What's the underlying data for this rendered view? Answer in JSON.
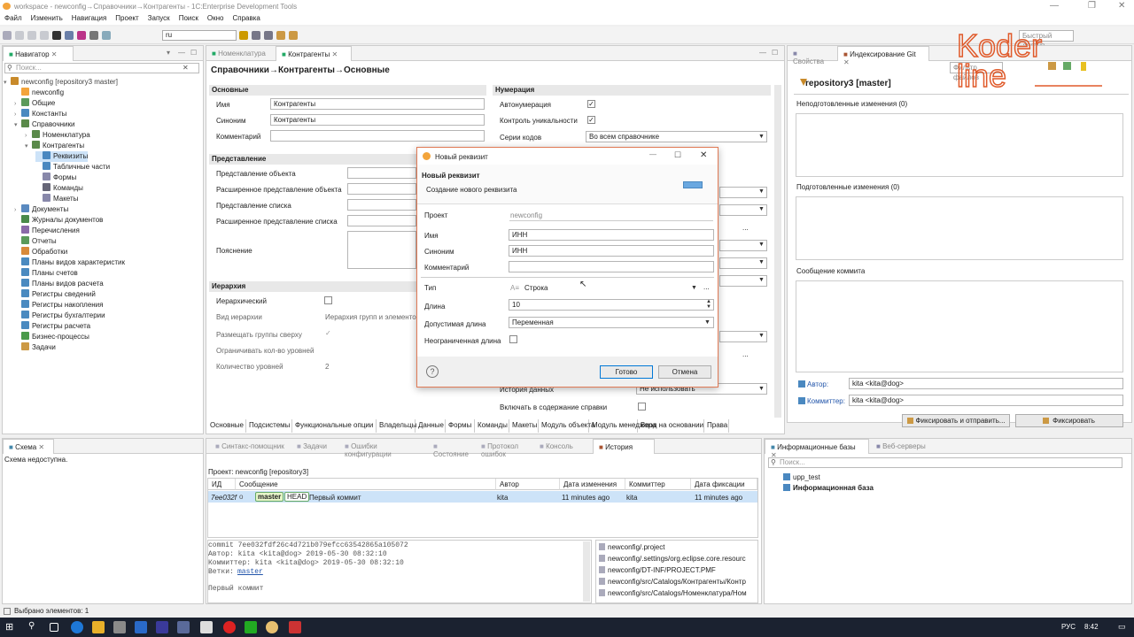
{
  "window": {
    "title": "workspace - newconfig→Справочники→Контрагенты - 1C:Enterprise Development Tools"
  },
  "menu": [
    "Файл",
    "Изменить",
    "Навигация",
    "Проект",
    "Запуск",
    "Поиск",
    "Окно",
    "Справка"
  ],
  "toolbar": {
    "lang_combo": "ru",
    "quick_access": "Быстрый доступ"
  },
  "navigator": {
    "tab": "Навигатор",
    "search_placeholder": "Поиск...",
    "items": [
      {
        "label": "newconfig [repository3 master]",
        "level": 0,
        "arrow": "▾"
      },
      {
        "label": "newconfig",
        "level": 1,
        "arrow": ""
      },
      {
        "label": "Общие",
        "level": 1,
        "arrow": "›"
      },
      {
        "label": "Константы",
        "level": 1,
        "arrow": "›"
      },
      {
        "label": "Справочники",
        "level": 1,
        "arrow": "▾"
      },
      {
        "label": "Номенклатура",
        "level": 2,
        "arrow": "›"
      },
      {
        "label": "Контрагенты",
        "level": 2,
        "arrow": "▾"
      },
      {
        "label": "Реквизиты",
        "level": 3,
        "arrow": ""
      },
      {
        "label": "Табличные части",
        "level": 3,
        "arrow": ""
      },
      {
        "label": "Формы",
        "level": 3,
        "arrow": ""
      },
      {
        "label": "Команды",
        "level": 3,
        "arrow": ""
      },
      {
        "label": "Макеты",
        "level": 3,
        "arrow": ""
      },
      {
        "label": "Документы",
        "level": 1,
        "arrow": "›"
      },
      {
        "label": "Журналы документов",
        "level": 1,
        "arrow": ""
      },
      {
        "label": "Перечисления",
        "level": 1,
        "arrow": ""
      },
      {
        "label": "Отчеты",
        "level": 1,
        "arrow": ""
      },
      {
        "label": "Обработки",
        "level": 1,
        "arrow": ""
      },
      {
        "label": "Планы видов характеристик",
        "level": 1,
        "arrow": ""
      },
      {
        "label": "Планы счетов",
        "level": 1,
        "arrow": ""
      },
      {
        "label": "Планы видов расчета",
        "level": 1,
        "arrow": ""
      },
      {
        "label": "Регистры сведений",
        "level": 1,
        "arrow": ""
      },
      {
        "label": "Регистры накопления",
        "level": 1,
        "arrow": ""
      },
      {
        "label": "Регистры бухгалтерии",
        "level": 1,
        "arrow": ""
      },
      {
        "label": "Регистры расчета",
        "level": 1,
        "arrow": ""
      },
      {
        "label": "Бизнес-процессы",
        "level": 1,
        "arrow": ""
      },
      {
        "label": "Задачи",
        "level": 1,
        "arrow": ""
      }
    ]
  },
  "editor": {
    "tabs": [
      "Номенклатура",
      "Контрагенты"
    ],
    "title": "Справочники→Контрагенты→Основные",
    "main": {
      "header": "Основные",
      "name_label": "Имя",
      "name": "Контрагенты",
      "synonym_label": "Синоним",
      "synonym": "Контрагенты",
      "comment_label": "Комментарий"
    },
    "numbering": {
      "header": "Нумерация",
      "autonum": "Автонумерация",
      "unique": "Контроль уникальности",
      "series_label": "Серии кодов",
      "series": "Во всем справочнике"
    },
    "presentation": {
      "header": "Представление",
      "object": "Представление объекта",
      "object_ext": "Расширенное представление объекта",
      "list": "Представление списка",
      "list_ext": "Расширенное представление списка",
      "explanation": "Пояснение"
    },
    "hierarchy": {
      "header": "Иерархия",
      "hierarchical": "Иерархический",
      "kind_label": "Вид иерархии",
      "kind": "Иерархия групп и элементо",
      "groups_top": "Размещать группы сверху",
      "limit": "Ограничивать кол-во уровней",
      "levels_label": "Количество уровней",
      "levels": "2"
    },
    "data_history_label": "История данных",
    "data_history": "Не использовать",
    "help_label": "Включать в содержание справки",
    "bottom_tabs": [
      "Основные",
      "Подсистемы",
      "Функциональные опции",
      "Владельцы",
      "Данные",
      "Формы",
      "Команды",
      "Макеты",
      "Модуль объекта",
      "Модуль менеджера",
      "Ввод на основании",
      "Права"
    ]
  },
  "dialog": {
    "title": "Новый реквизит",
    "heading": "Новый реквизит",
    "subtitle": "Создание нового реквизита",
    "project_label": "Проект",
    "project": "newconfig",
    "name_label": "Имя",
    "name": "ИНН",
    "synonym_label": "Синоним",
    "synonym": "ИНН",
    "comment_label": "Комментарий",
    "comment": "",
    "type_label": "Тип",
    "type": "Строка",
    "length_label": "Длина",
    "length": "10",
    "allowed_length_label": "Допустимая длина",
    "allowed_length": "Переменная",
    "unlimited_label": "Неограниченная длина",
    "ok": "Готово",
    "cancel": "Отмена"
  },
  "git": {
    "tabs": [
      "Свойства",
      "Индексирование Git"
    ],
    "filter_placeholder": "Фильтр файлов",
    "repo": "repository3 [master]",
    "unstaged": "Неподготовленные изменения (0)",
    "staged": "Подготовленные изменения (0)",
    "commit_msg": "Сообщение коммита",
    "author_label": "Автор:",
    "author": "kita <kita@dog>",
    "committer_label": "Коммиттер:",
    "committer": "kita <kita@dog>",
    "commit_push": "Фиксировать и отправить...",
    "commit": "Фиксировать"
  },
  "schema": {
    "tab": "Схема",
    "message": "Схема недоступна."
  },
  "history": {
    "tabs": [
      "Синтакс-помощник",
      "Задачи",
      "Ошибки конфигурации",
      "Состояние",
      "Протокол ошибок",
      "Консоль",
      "История"
    ],
    "project": "Проект: newconfig [repository3]",
    "columns": [
      "ИД",
      "Сообщение",
      "Автор",
      "Дата изменения",
      "Коммиттер",
      "Дата фиксации"
    ],
    "row": {
      "id": "7ee032f",
      "branch": "master",
      "head": "HEAD",
      "message": "Первый коммит",
      "author": "kita",
      "date": "11 minutes ago",
      "committer": "kita",
      "commit_date": "11 minutes ago"
    },
    "details": [
      "commit 7ee032fdf26c4d721b079efcc63542865a105072",
      "Автор: kita <kita@dog> 2019-05-30 08:32:10",
      "Коммиттер: kita <kita@dog> 2019-05-30 08:32:10"
    ],
    "branches_label": "Ветки:",
    "branches": "master",
    "msg": "Первый коммит",
    "files": [
      "newconfig/.project",
      "newconfig/.settings/org.eclipse.core.resourc",
      "newconfig/DT-INF/PROJECT.PMF",
      "newconfig/src/Catalogs/Контрагенты/Контр",
      "newconfig/src/Catalogs/Номенклатура/Ном"
    ]
  },
  "infobases": {
    "tabs": [
      "Информационные базы",
      "Веб-серверы"
    ],
    "search_placeholder": "Поиск...",
    "items": [
      "upp_test",
      "Информационная база"
    ]
  },
  "status": {
    "selected": "Выбрано элементов: 1"
  },
  "taskbar": {
    "lang": "РУС",
    "time": "8:42"
  },
  "logo": {
    "line1": "Koder",
    "line2": "line"
  }
}
